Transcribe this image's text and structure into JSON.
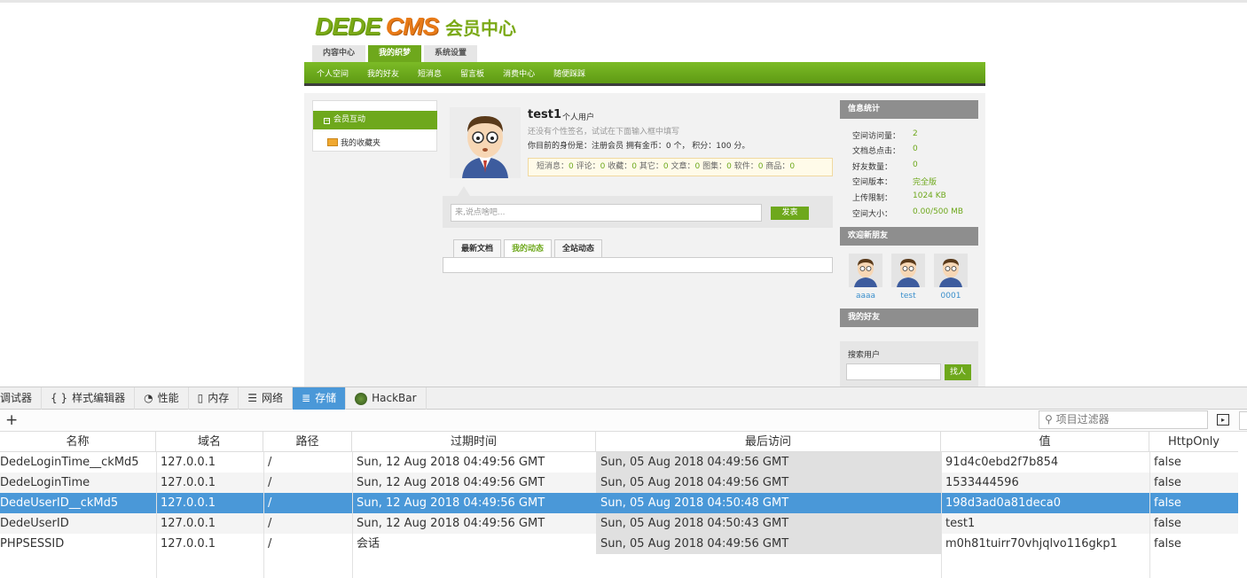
{
  "site": {
    "logo_dede": "DEDE",
    "logo_cms": "CMS",
    "logo_sub": "会员中心",
    "main_tabs": [
      "内容中心",
      "我的织梦",
      "系统设置"
    ],
    "sub_nav": [
      "个人空间",
      "我的好友",
      "短消息",
      "留言板",
      "消费中心",
      "随便踩踩"
    ],
    "left_menu": {
      "active": "会员互动",
      "item": "我的收藏夹"
    },
    "user": {
      "name": "test1",
      "type": "个人用户",
      "signature": "还没有个性签名，试试在下面输入框中填写",
      "info": "你目前的身份是：注册会员 拥有金币：0 个， 积分：100 分。",
      "stats": [
        {
          "k": "短消息：",
          "v": "0"
        },
        {
          "k": " 评论：",
          "v": "0"
        },
        {
          "k": " 收藏：",
          "v": "0"
        },
        {
          "k": " 其它：",
          "v": "0"
        },
        {
          "k": " 文章：",
          "v": "0"
        },
        {
          "k": " 图集：",
          "v": "0"
        },
        {
          "k": " 软件：",
          "v": "0"
        },
        {
          "k": " 商品：",
          "v": "0"
        }
      ]
    },
    "say_placeholder": "来,说点啥吧...",
    "say_button": "发表",
    "feed_tabs": [
      "最新文档",
      "我的动态",
      "全站动态"
    ],
    "info_title": "信息统计",
    "info_stats": [
      {
        "k": "空间访问量：",
        "v": "2"
      },
      {
        "k": "文档总点击：",
        "v": "0"
      },
      {
        "k": "好友数量：",
        "v": "0"
      },
      {
        "k": "空间版本：",
        "v": "完全版"
      },
      {
        "k": "上传限制：",
        "v": "1024 KB"
      },
      {
        "k": "空间大小：",
        "v": "0.00/500 MB"
      }
    ],
    "new_friends_title": "欢迎新朋友",
    "new_friends": [
      "aaaa",
      "test",
      "0001"
    ],
    "my_friends_title": "我的好友",
    "search_label": "搜索用户",
    "search_button": "找人"
  },
  "devtools": {
    "tabs": [
      {
        "label": "调试器",
        "icon": "debugger-icon",
        "glyph": ""
      },
      {
        "label": "样式编辑器",
        "icon": "style-editor-icon",
        "glyph": "{ }"
      },
      {
        "label": "性能",
        "icon": "performance-icon",
        "glyph": "◔"
      },
      {
        "label": "内存",
        "icon": "memory-icon",
        "glyph": "▯"
      },
      {
        "label": "网络",
        "icon": "network-icon",
        "glyph": "☰"
      },
      {
        "label": "存储",
        "icon": "storage-icon",
        "glyph": "≣"
      },
      {
        "label": "HackBar",
        "icon": "hackbar-icon",
        "glyph": ""
      }
    ],
    "active_tab": "存储",
    "filter_placeholder": "项目过滤器",
    "columns": [
      "名称",
      "域名",
      "路径",
      "过期时间",
      "最后访问",
      "值",
      "HttpOnly"
    ],
    "cookies": [
      {
        "name": "DedeLoginTime__ckMd5",
        "domain": "127.0.0.1",
        "path": "/",
        "expires": "Sun, 12 Aug 2018 04:49:56 GMT",
        "last": "Sun, 05 Aug 2018 04:49:56 GMT",
        "value": "91d4c0ebd2f7b854",
        "httponly": "false"
      },
      {
        "name": "DedeLoginTime",
        "domain": "127.0.0.1",
        "path": "/",
        "expires": "Sun, 12 Aug 2018 04:49:56 GMT",
        "last": "Sun, 05 Aug 2018 04:49:56 GMT",
        "value": "1533444596",
        "httponly": "false"
      },
      {
        "name": "DedeUserID__ckMd5",
        "domain": "127.0.0.1",
        "path": "/",
        "expires": "Sun, 12 Aug 2018 04:49:56 GMT",
        "last": "Sun, 05 Aug 2018 04:50:48 GMT",
        "value": "198d3ad0a81deca0",
        "httponly": "false"
      },
      {
        "name": "DedeUserID",
        "domain": "127.0.0.1",
        "path": "/",
        "expires": "Sun, 12 Aug 2018 04:49:56 GMT",
        "last": "Sun, 05 Aug 2018 04:50:43 GMT",
        "value": "test1",
        "httponly": "false"
      },
      {
        "name": "PHPSESSID",
        "domain": "127.0.0.1",
        "path": "/",
        "expires": "会话",
        "last": "Sun, 05 Aug 2018 04:49:56 GMT",
        "value": "m0h81tuirr70vhjqlvo116gkp1",
        "httponly": "false"
      }
    ],
    "selected_row": 2
  }
}
